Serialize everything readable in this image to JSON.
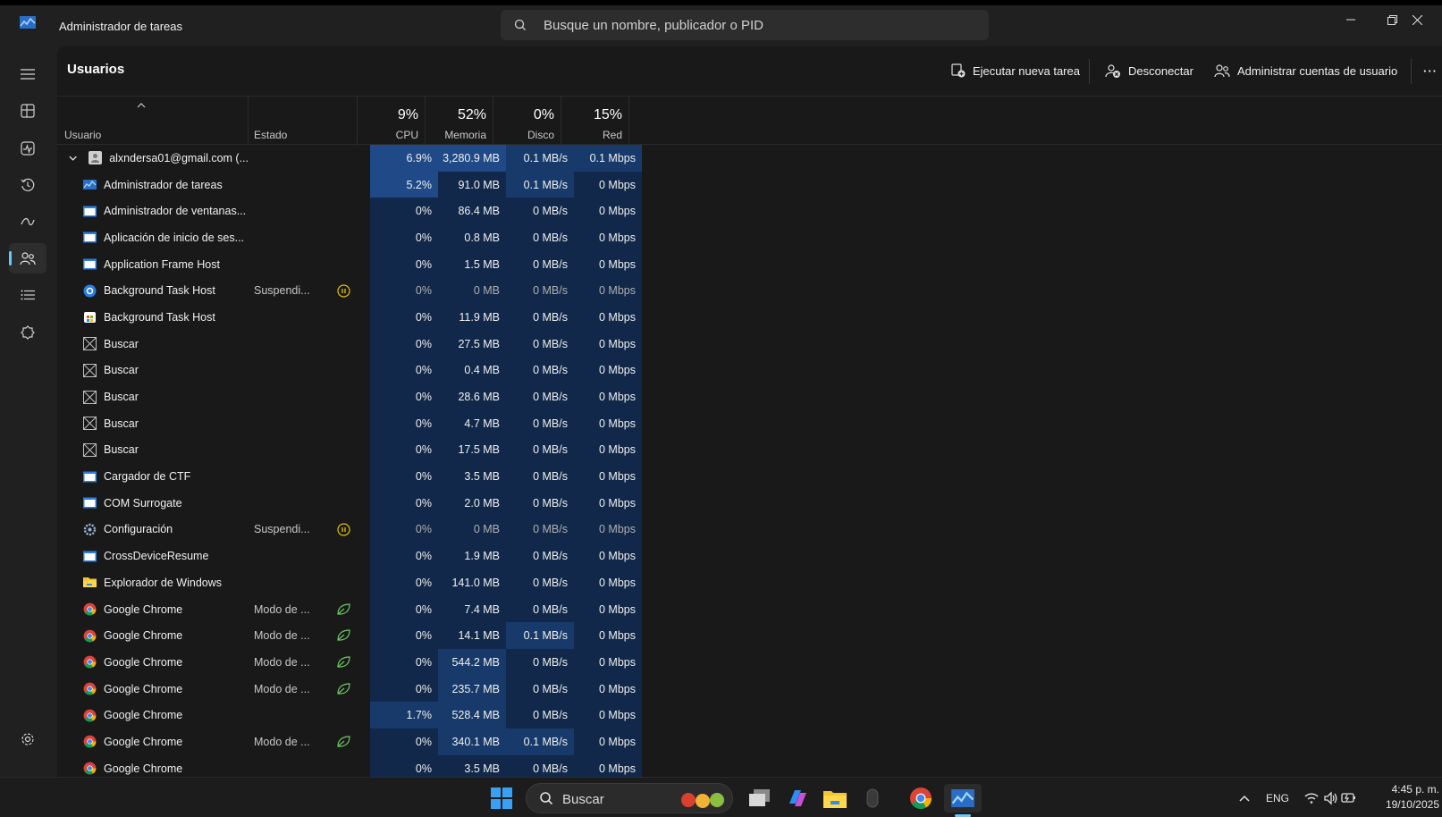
{
  "window": {
    "title": "Administrador de tareas",
    "search_placeholder": "Busque un nombre, publicador o PID"
  },
  "sidebar": {
    "items": [
      {
        "icon": "hamburger-menu-icon"
      },
      {
        "icon": "processes-icon"
      },
      {
        "icon": "performance-icon"
      },
      {
        "icon": "app-history-icon"
      },
      {
        "icon": "startup-apps-icon"
      },
      {
        "icon": "users-icon",
        "active": true
      },
      {
        "icon": "details-icon"
      },
      {
        "icon": "services-icon"
      },
      {
        "icon": "settings-icon"
      }
    ]
  },
  "page": {
    "title": "Usuarios",
    "actions": {
      "run_task": "Ejecutar nueva tarea",
      "disconnect": "Desconectar",
      "manage_accounts": "Administrar cuentas de usuario",
      "more": "···"
    }
  },
  "columns": {
    "user": "Usuario",
    "state": "Estado",
    "cpu": {
      "label": "CPU",
      "pct": "9%"
    },
    "memory": {
      "label": "Memoria",
      "pct": "52%"
    },
    "disk": {
      "label": "Disco",
      "pct": "0%"
    },
    "network": {
      "label": "Red",
      "pct": "15%"
    }
  },
  "rows": [
    {
      "name": "alxndersa01@gmail.com (...",
      "icon": "user",
      "group": true,
      "state": "",
      "sicon": "",
      "cpu": "6.9%",
      "mem": "3,280.9 MB",
      "disk": "0.1 MB/s",
      "net": "0.1 Mbps"
    },
    {
      "name": "Administrador de tareas",
      "icon": "taskmgr",
      "state": "",
      "sicon": "",
      "cpu": "5.2%",
      "mem": "91.0 MB",
      "disk": "0.1 MB/s",
      "net": "0 Mbps"
    },
    {
      "name": "Administrador de ventanas...",
      "icon": "window",
      "state": "",
      "sicon": "",
      "cpu": "0%",
      "mem": "86.4 MB",
      "disk": "0 MB/s",
      "net": "0 Mbps"
    },
    {
      "name": "Aplicación de inicio de ses...",
      "icon": "window",
      "state": "",
      "sicon": "",
      "cpu": "0%",
      "mem": "0.8 MB",
      "disk": "0 MB/s",
      "net": "0 Mbps"
    },
    {
      "name": "Application Frame Host",
      "icon": "window",
      "state": "",
      "sicon": "",
      "cpu": "0%",
      "mem": "1.5 MB",
      "disk": "0 MB/s",
      "net": "0 Mbps"
    },
    {
      "name": "Background Task Host",
      "icon": "bthost",
      "state": "Suspendi...",
      "sicon": "pause",
      "cpu": "0%",
      "mem": "0 MB",
      "disk": "0 MB/s",
      "net": "0 Mbps"
    },
    {
      "name": "Background Task Host",
      "icon": "store",
      "state": "",
      "sicon": "",
      "cpu": "0%",
      "mem": "11.9 MB",
      "disk": "0 MB/s",
      "net": "0 Mbps"
    },
    {
      "name": "Buscar",
      "icon": "blank",
      "state": "",
      "sicon": "",
      "cpu": "0%",
      "mem": "27.5 MB",
      "disk": "0 MB/s",
      "net": "0 Mbps"
    },
    {
      "name": "Buscar",
      "icon": "blank",
      "state": "",
      "sicon": "",
      "cpu": "0%",
      "mem": "0.4 MB",
      "disk": "0 MB/s",
      "net": "0 Mbps"
    },
    {
      "name": "Buscar",
      "icon": "blank",
      "state": "",
      "sicon": "",
      "cpu": "0%",
      "mem": "28.6 MB",
      "disk": "0 MB/s",
      "net": "0 Mbps"
    },
    {
      "name": "Buscar",
      "icon": "blank",
      "state": "",
      "sicon": "",
      "cpu": "0%",
      "mem": "4.7 MB",
      "disk": "0 MB/s",
      "net": "0 Mbps"
    },
    {
      "name": "Buscar",
      "icon": "blank",
      "state": "",
      "sicon": "",
      "cpu": "0%",
      "mem": "17.5 MB",
      "disk": "0 MB/s",
      "net": "0 Mbps"
    },
    {
      "name": "Cargador de CTF",
      "icon": "window",
      "state": "",
      "sicon": "",
      "cpu": "0%",
      "mem": "3.5 MB",
      "disk": "0 MB/s",
      "net": "0 Mbps"
    },
    {
      "name": "COM Surrogate",
      "icon": "window",
      "state": "",
      "sicon": "",
      "cpu": "0%",
      "mem": "2.0 MB",
      "disk": "0 MB/s",
      "net": "0 Mbps"
    },
    {
      "name": "Configuración",
      "icon": "gear",
      "state": "Suspendi...",
      "sicon": "pause",
      "cpu": "0%",
      "mem": "0 MB",
      "disk": "0 MB/s",
      "net": "0 Mbps"
    },
    {
      "name": "CrossDeviceResume",
      "icon": "window",
      "state": "",
      "sicon": "",
      "cpu": "0%",
      "mem": "1.9 MB",
      "disk": "0 MB/s",
      "net": "0 Mbps"
    },
    {
      "name": "Explorador de Windows",
      "icon": "folder",
      "state": "",
      "sicon": "",
      "cpu": "0%",
      "mem": "141.0 MB",
      "disk": "0 MB/s",
      "net": "0 Mbps"
    },
    {
      "name": "Google Chrome",
      "icon": "chrome",
      "state": "Modo de ...",
      "sicon": "leaf",
      "cpu": "0%",
      "mem": "7.4 MB",
      "disk": "0 MB/s",
      "net": "0 Mbps"
    },
    {
      "name": "Google Chrome",
      "icon": "chrome",
      "state": "Modo de ...",
      "sicon": "leaf",
      "cpu": "0%",
      "mem": "14.1 MB",
      "disk": "0.1 MB/s",
      "net": "0 Mbps"
    },
    {
      "name": "Google Chrome",
      "icon": "chrome",
      "state": "Modo de ...",
      "sicon": "leaf",
      "cpu": "0%",
      "mem": "544.2 MB",
      "disk": "0 MB/s",
      "net": "0 Mbps"
    },
    {
      "name": "Google Chrome",
      "icon": "chrome",
      "state": "Modo de ...",
      "sicon": "leaf",
      "cpu": "0%",
      "mem": "235.7 MB",
      "disk": "0 MB/s",
      "net": "0 Mbps"
    },
    {
      "name": "Google Chrome",
      "icon": "chrome",
      "state": "",
      "sicon": "",
      "cpu": "1.7%",
      "mem": "528.4 MB",
      "disk": "0 MB/s",
      "net": "0 Mbps"
    },
    {
      "name": "Google Chrome",
      "icon": "chrome",
      "state": "Modo de ...",
      "sicon": "leaf",
      "cpu": "0%",
      "mem": "340.1 MB",
      "disk": "0.1 MB/s",
      "net": "0 Mbps"
    },
    {
      "name": "Google Chrome",
      "icon": "chrome",
      "state": "",
      "sicon": "",
      "cpu": "0%",
      "mem": "3.5 MB",
      "disk": "0 MB/s",
      "net": "0 Mbps"
    }
  ],
  "taskbar": {
    "search_label": "Buscar",
    "lang": "ENG",
    "time": "4:45 p. m.",
    "date": "19/10/2025"
  },
  "colors": {
    "heat_high": "#1f4a87",
    "heat_mid": "#173a6a",
    "heat_low": "#11284a",
    "accent": "#60cdff",
    "pause": "#e6c400",
    "leaf": "#6ccb5f"
  }
}
